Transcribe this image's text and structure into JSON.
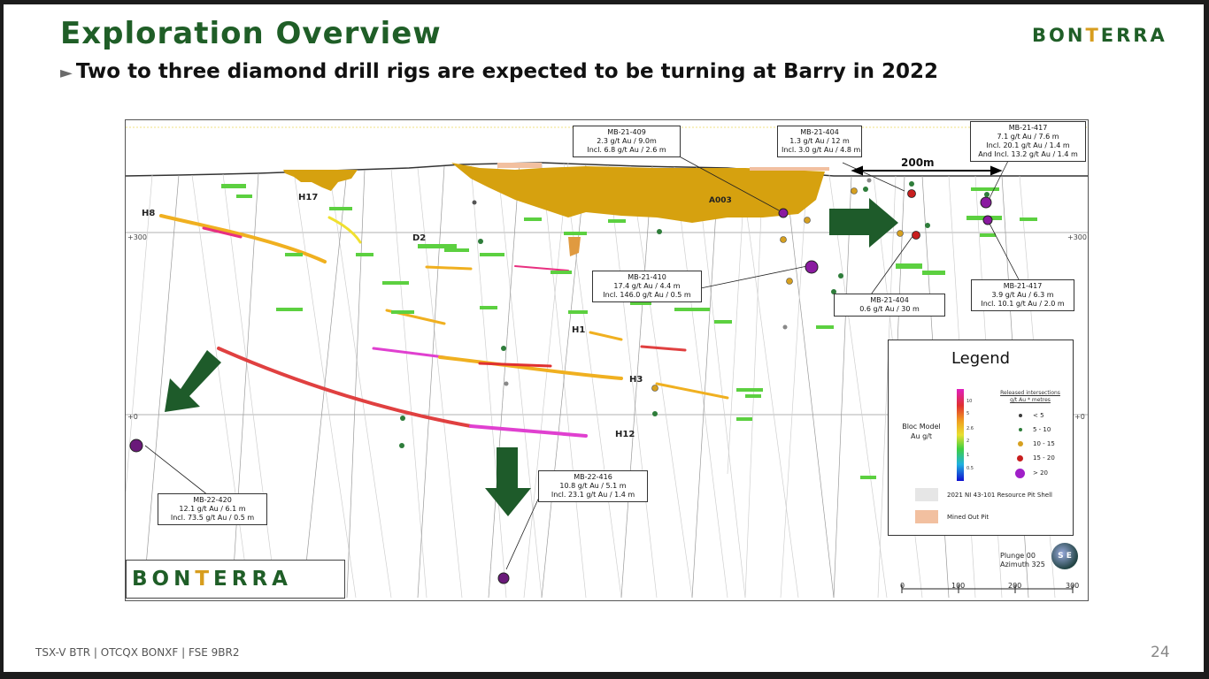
{
  "header": {
    "title": "Exploration Overview",
    "subtitle": "Two to three diamond drill rigs are expected to be turning at Barry in 2022",
    "subtitle_marker": "►"
  },
  "logo": {
    "part1": "BON",
    "t": "T",
    "part2": "ERRA"
  },
  "colors": {
    "brand_green": "#1f5e27",
    "brand_gold": "#d79d1e",
    "pit_gold": "#d6a10f",
    "arrow_green": "#1e5b2a"
  },
  "section": {
    "zone_labels": [
      "H17",
      "H8",
      "D2",
      "A003",
      "H1",
      "H3",
      "H12"
    ],
    "elevation_labels": {
      "plus300_left": "+300",
      "plus300_right": "+300",
      "zero_left": "+0",
      "zero_right": "+0"
    },
    "scale_label": "200m",
    "callouts": [
      {
        "hole": "MB-21-409",
        "lines": [
          "2.3 g/t Au / 9.0m",
          "Incl. 6.8 g/t Au / 2.6 m"
        ]
      },
      {
        "hole": "MB-21-404",
        "lines": [
          "1.3 g/t Au / 12 m",
          "Incl. 3.0 g/t Au / 4.8 m"
        ]
      },
      {
        "hole": "MB-21-417",
        "lines": [
          "7.1 g/t Au / 7.6 m",
          "Incl. 20.1 g/t Au / 1.4 m",
          "And Incl. 13.2 g/t Au / 1.4 m"
        ]
      },
      {
        "hole": "MB-21-410",
        "lines": [
          "17.4 g/t Au / 4.4 m",
          "Incl. 146.0 g/t Au / 0.5 m"
        ]
      },
      {
        "hole": "MB-21-404",
        "lines": [
          "0.6 g/t Au / 30 m"
        ]
      },
      {
        "hole": "MB-21-417",
        "lines": [
          "3.9 g/t Au / 6.3 m",
          "Incl. 10.1 g/t Au / 2.0 m"
        ]
      },
      {
        "hole": "MB-22-420",
        "lines": [
          "12.1 g/t Au / 6.1 m",
          "Incl. 73.5 g/t Au / 0.5 m"
        ]
      },
      {
        "hole": "MB-22-416",
        "lines": [
          "10.8 g/t Au / 5.1 m",
          "Incl. 23.1 g/t Au / 1.4 m"
        ]
      }
    ]
  },
  "legend": {
    "title": "Legend",
    "bloc_label_1": "Bloc Model",
    "bloc_label_2": "Au g/t",
    "bar_ticks": [
      "10",
      "5",
      "2.6",
      "2",
      "1",
      "0.5"
    ],
    "released_title_1": "Released intersections",
    "released_title_2": "g/t Au * metres",
    "dot_labels": [
      "< 5",
      "5 - 10",
      "10 - 15",
      "15 - 20",
      "> 20"
    ],
    "dot_colors": [
      "#3c3c3c",
      "#2e7d3a",
      "#d6a020",
      "#c81e1e",
      "#a020c8"
    ],
    "swatch_1": "2021 NI 43-101 Resource Pit Shell",
    "swatch_2": "Mined Out Pit"
  },
  "orientation": {
    "plunge": "Plunge 00",
    "azimuth": "Azimuth 325",
    "compass": "S E"
  },
  "scalebar": [
    "0",
    "100",
    "200",
    "300"
  ],
  "footer": {
    "tickers": "TSX-V  BTR  | OTCQX  BONXF  | FSE  9BR2",
    "page": "24"
  }
}
